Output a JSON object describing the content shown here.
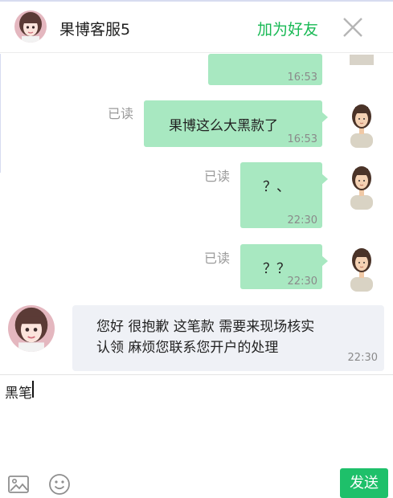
{
  "header": {
    "title": "果博客服5",
    "add_friend": "加为好友",
    "close_icon": "close-icon"
  },
  "messages": [
    {
      "direction": "out",
      "text": "",
      "time": "16:53",
      "read": ""
    },
    {
      "direction": "out",
      "text": "果博这么大黑款了",
      "time": "16:53",
      "read": "已读"
    },
    {
      "direction": "out",
      "text": "？、",
      "time": "22:30",
      "read": "已读"
    },
    {
      "direction": "out",
      "text": "？？",
      "time": "22:30",
      "read": "已读"
    },
    {
      "direction": "in",
      "line1": "您好 很抱歉 这笔款 需要来现场核实",
      "line2": "认领 麻烦您联系您开户的处理",
      "time": "22:30"
    }
  ],
  "composer": {
    "text": "黑笔",
    "send_label": "发送",
    "tools": [
      "image-icon",
      "emoji-icon"
    ]
  },
  "colors": {
    "outgoing_bubble": "#a8e8c1",
    "incoming_bubble": "#eff1f6",
    "accent": "#19b955",
    "send_button": "#1ec06a"
  }
}
